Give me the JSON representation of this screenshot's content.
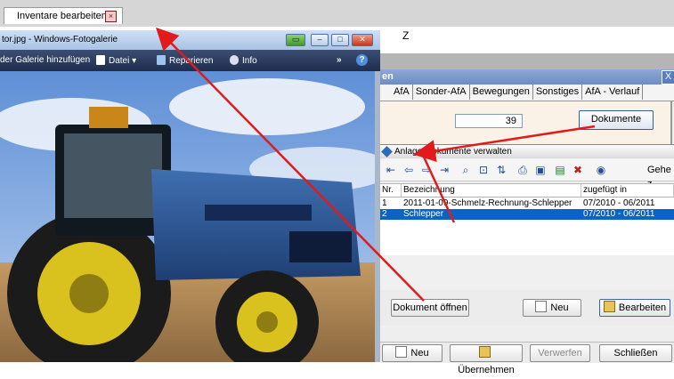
{
  "top_tab": {
    "title": "Inventare bearbeiten",
    "close_glyph": "×"
  },
  "header_field": {
    "value": "Z"
  },
  "dialog": {
    "title_fragment": "en",
    "close_glyph": "X",
    "tabs": [
      "AfA",
      "Sonder-AfA",
      "Bewegungen",
      "Sonstiges",
      "AfA - Verlauf"
    ],
    "count_value": "39",
    "documents_button": "Dokumente",
    "bottom_buttons": {
      "new": "Neu",
      "apply": "Übernehmen",
      "discard": "Verwerfen",
      "close": "Schließen"
    }
  },
  "subwindow": {
    "title": "Anlagendokumente verwalten",
    "goto_label": "Gehe z",
    "columns": [
      "Nr.",
      "Bezeichnung",
      "zugefügt in"
    ],
    "rows": [
      {
        "nr": "1",
        "name": "2011-01-09-Schmelz-Rechnung-Schlepper",
        "period": "07/2010 - 06/2011"
      },
      {
        "nr": "2",
        "name": "Schlepper",
        "period": "07/2010 - 06/2011"
      }
    ],
    "buttons": {
      "open": "Dokument öffnen",
      "new": "Neu",
      "edit": "Bearbeiten"
    }
  },
  "gallery": {
    "title": "tor.jpg - Windows-Fotogalerie",
    "menu": {
      "add": "der Galerie hinzufügen",
      "file": "Datei",
      "repair": "Reparieren",
      "info": "Info"
    },
    "more_glyph": "»",
    "help_glyph": "?"
  },
  "colors": {
    "selection": "#0a64c8",
    "arrow": "#e11b1b",
    "titlebar": "#7193cc"
  }
}
